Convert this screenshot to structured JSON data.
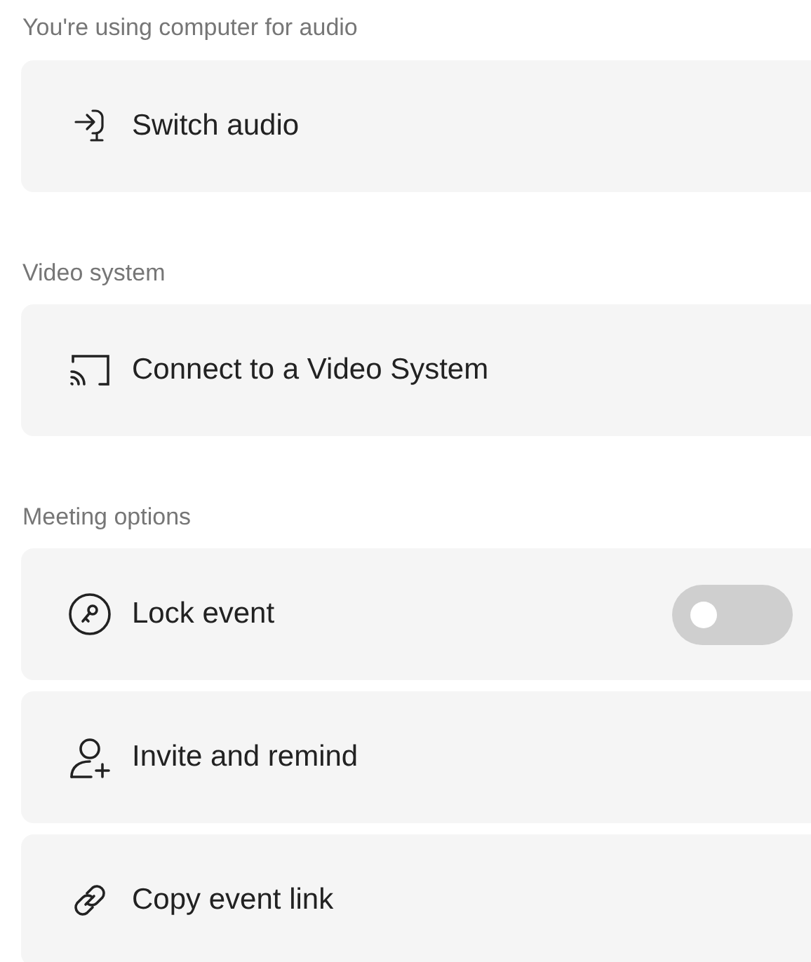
{
  "sections": [
    {
      "heading": "You're using computer for audio",
      "items": [
        {
          "kind": "action",
          "label": "Switch audio"
        }
      ]
    },
    {
      "heading": "Video system",
      "items": [
        {
          "kind": "action",
          "label": "Connect to a Video System"
        }
      ]
    },
    {
      "heading": "Meeting options",
      "items": [
        {
          "kind": "toggle",
          "label": "Lock event",
          "on": false
        },
        {
          "kind": "action",
          "label": "Invite and remind"
        },
        {
          "kind": "action",
          "label": "Copy event link"
        }
      ]
    }
  ]
}
